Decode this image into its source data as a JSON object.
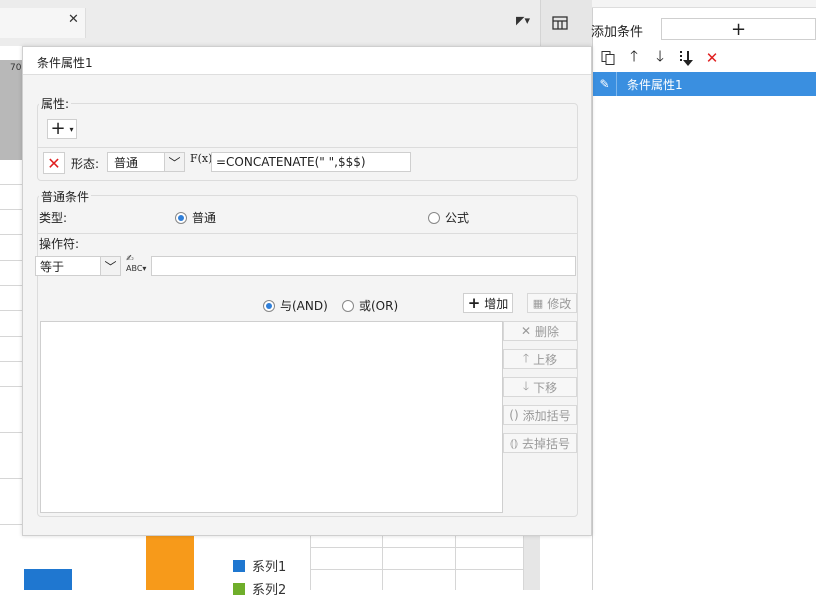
{
  "background": {
    "ruler_number": "70",
    "legend": [
      {
        "label": "系列1",
        "color": "#1f77d0"
      },
      {
        "label": "系列2",
        "color": "#6fae2b"
      }
    ]
  },
  "side_panel": {
    "top_text": "条件属性",
    "add_condition_label": "添加条件",
    "add_button_label": "+",
    "toolbar_icons": [
      "copy-icon",
      "arrow-up-icon",
      "arrow-down-icon",
      "move-bottom-icon",
      "delete-icon"
    ],
    "items": [
      {
        "label": "条件属性1",
        "selected": true
      }
    ],
    "selected_color": "#3a8fe0"
  },
  "dialog": {
    "title": "条件属性1",
    "properties": {
      "group_title": "属性:",
      "shape_label": "形态:",
      "shape_value": "普通",
      "formula_label": "F(x)",
      "formula_value": "=CONCATENATE(\" \",$$$)"
    },
    "condition": {
      "group_title": "普通条件",
      "type_label": "类型:",
      "type_normal": "普通",
      "type_formula": "公式",
      "operator_label": "操作符:",
      "operator_value": "等于",
      "value_input": "",
      "and_label": "与(AND)",
      "or_label": "或(OR)",
      "add_button": "增加",
      "modify_button": "修改",
      "side_buttons": [
        "删除",
        "上移",
        "下移",
        "添加括号",
        "去掉括号"
      ]
    }
  }
}
